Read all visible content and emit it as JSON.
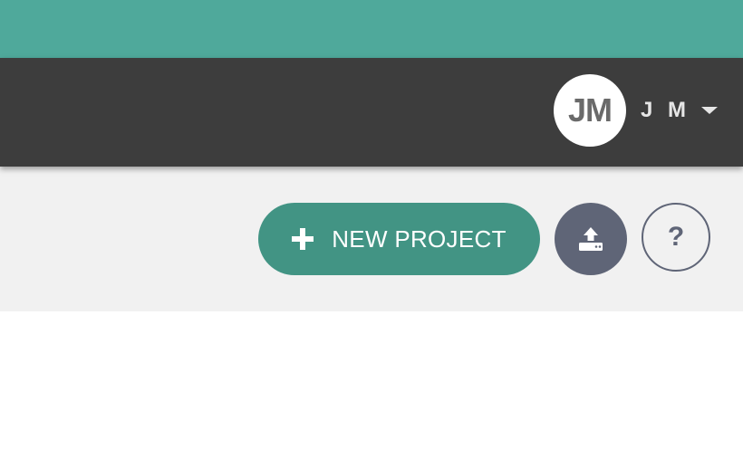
{
  "header": {
    "user": {
      "initials": "JM",
      "name": "J M"
    }
  },
  "toolbar": {
    "new_project_label": "NEW PROJECT",
    "help_label": "?"
  },
  "icons": {
    "add": "plus-icon",
    "upload": "upload-icon",
    "dropdown": "caret-down-icon",
    "help": "question-icon"
  },
  "colors": {
    "top_band": "#4fa99b",
    "header": "#3d3d3d",
    "primary_button": "#429484",
    "secondary_button": "#5f6577",
    "toolbar_background": "#f1f1f1"
  }
}
